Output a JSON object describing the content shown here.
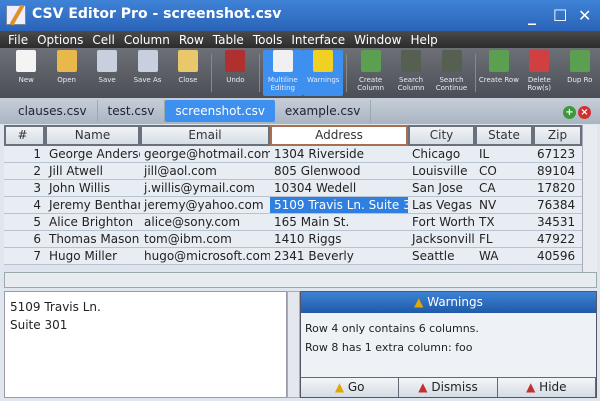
{
  "title": "CSV Editor Pro - screenshot.csv",
  "window_controls": {
    "minimize": "_",
    "maximize": "☐",
    "close": "✕"
  },
  "menu": [
    "File",
    "Options",
    "Cell",
    "Column",
    "Row",
    "Table",
    "Tools",
    "Interface",
    "Window",
    "Help"
  ],
  "toolbar": [
    {
      "label": "New",
      "icon": "new-file-icon",
      "color": "#f4f4f4"
    },
    {
      "label": "Open",
      "icon": "open-folder-icon",
      "color": "#e8b84a"
    },
    {
      "label": "Save",
      "icon": "save-icon",
      "color": "#c8d0e0"
    },
    {
      "label": "Save As",
      "icon": "save-as-icon",
      "color": "#c8d0e0"
    },
    {
      "label": "Close",
      "icon": "close-file-icon",
      "color": "#e8c86a"
    },
    {
      "label": "Undo",
      "icon": "undo-icon",
      "color": "#b03030"
    },
    {
      "label": "Multiline Editing",
      "icon": "multiline-edit-icon",
      "color": "#f0f0f0",
      "active": true
    },
    {
      "label": "Warnings",
      "icon": "warning-icon",
      "color": "#f0d020",
      "active": true
    },
    {
      "label": "Create Column",
      "icon": "create-column-icon",
      "color": "#5aa050"
    },
    {
      "label": "Search Column",
      "icon": "binoculars-icon",
      "color": "#556050"
    },
    {
      "label": "Search Continue",
      "icon": "search-continue-icon",
      "color": "#556050"
    },
    {
      "label": "Create Row",
      "icon": "create-row-icon",
      "color": "#5aa050"
    },
    {
      "label": "Delete Row(s)",
      "icon": "delete-row-icon",
      "color": "#d04040"
    },
    {
      "label": "Dup Ro",
      "icon": "duplicate-row-icon",
      "color": "#5aa050"
    }
  ],
  "tabs": [
    {
      "label": "clauses.csv"
    },
    {
      "label": "test.csv"
    },
    {
      "label": "screenshot.csv",
      "active": true
    },
    {
      "label": "example.csv"
    }
  ],
  "grid": {
    "columns": [
      "#",
      "Name",
      "Email",
      "Address",
      "City",
      "State",
      "Zip"
    ],
    "rows": [
      [
        "1",
        "George Anderson",
        "george@hotmail.com",
        "1304 Riverside",
        "Chicago",
        "IL",
        "67123"
      ],
      [
        "2",
        "Jill Atwell",
        "jill@aol.com",
        "805 Glenwood",
        "Louisville",
        "CO",
        "89104"
      ],
      [
        "3",
        "John Willis",
        "j.willis@ymail.com",
        "10304 Wedell",
        "San Jose",
        "CA",
        "17820"
      ],
      [
        "4",
        "Jeremy Bentham",
        "jeremy@yahoo.com",
        "5109 Travis Ln. Suite 301",
        "Las Vegas",
        "NV",
        "76384"
      ],
      [
        "5",
        "Alice Brighton",
        "alice@sony.com",
        "165 Main St.",
        "Fort Worth",
        "TX",
        "34531"
      ],
      [
        "6",
        "Thomas Mason",
        "tom@ibm.com",
        "1410 Riggs",
        "Jacksonville",
        "FL",
        "47922"
      ],
      [
        "7",
        "Hugo Miller",
        "hugo@microsoft.com",
        "2341 Beverly",
        "Seattle",
        "WA",
        "40596"
      ]
    ]
  },
  "editor": {
    "line1": "5109 Travis Ln.",
    "line2": "Suite 301"
  },
  "warnings": {
    "title": "Warnings",
    "messages": [
      "Row 4 only contains 6 columns.",
      "Row 8 has 1 extra column: foo"
    ],
    "buttons": [
      "Go",
      "Dismiss",
      "Hide"
    ]
  }
}
